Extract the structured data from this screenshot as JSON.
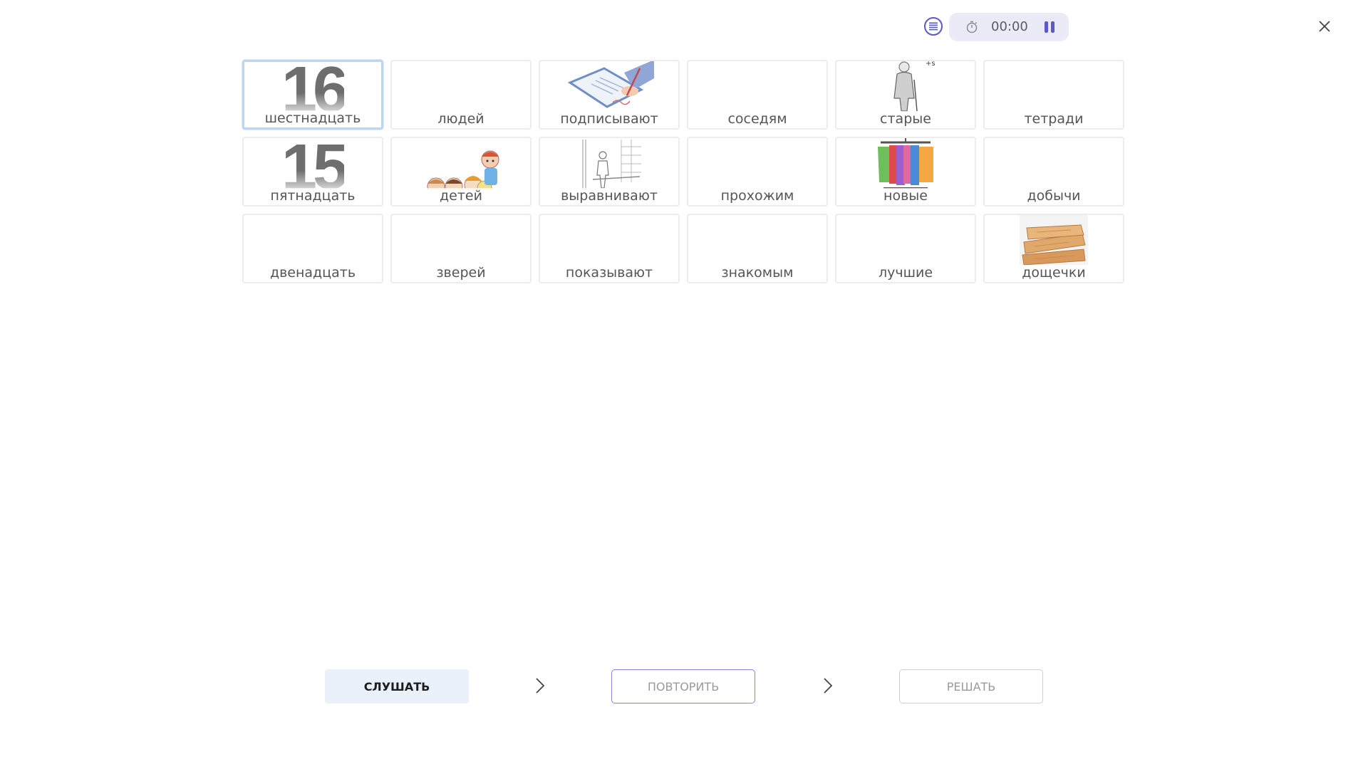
{
  "header": {
    "timer": "00:00",
    "list_icon": "list-icon",
    "stopwatch_icon": "stopwatch-icon",
    "pause_icon": "pause-icon",
    "close_icon": "close-icon"
  },
  "cards": [
    {
      "label": "шестнадцать",
      "picture": "16",
      "selected": true
    },
    {
      "label": "людей",
      "picture": ""
    },
    {
      "label": "подписывают",
      "picture": "signing-contract-image"
    },
    {
      "label": "соседям",
      "picture": ""
    },
    {
      "label": "старые",
      "picture": "old-man-image"
    },
    {
      "label": "тетради",
      "picture": ""
    },
    {
      "label": "пятнадцать",
      "picture": "15"
    },
    {
      "label": "детей",
      "picture": "children-image"
    },
    {
      "label": "выравнивают",
      "picture": "aligning-image"
    },
    {
      "label": "прохожим",
      "picture": ""
    },
    {
      "label": "новые",
      "picture": "clothes-rack-image"
    },
    {
      "label": "добычи",
      "picture": ""
    },
    {
      "label": "двенадцать",
      "picture": ""
    },
    {
      "label": "зверей",
      "picture": ""
    },
    {
      "label": "показывают",
      "picture": ""
    },
    {
      "label": "знакомым",
      "picture": ""
    },
    {
      "label": "лучшие",
      "picture": ""
    },
    {
      "label": "дощечки",
      "picture": "wooden-planks-image"
    }
  ],
  "footer": {
    "listen_label": "СЛУШАТЬ",
    "repeat_label": "ПОВТОРИТЬ",
    "solve_label": "РЕШАТЬ"
  },
  "colors": {
    "accent": "#5b58c9",
    "listen_bg": "#eaf1fb",
    "selected_border": "#bcd6ee"
  }
}
